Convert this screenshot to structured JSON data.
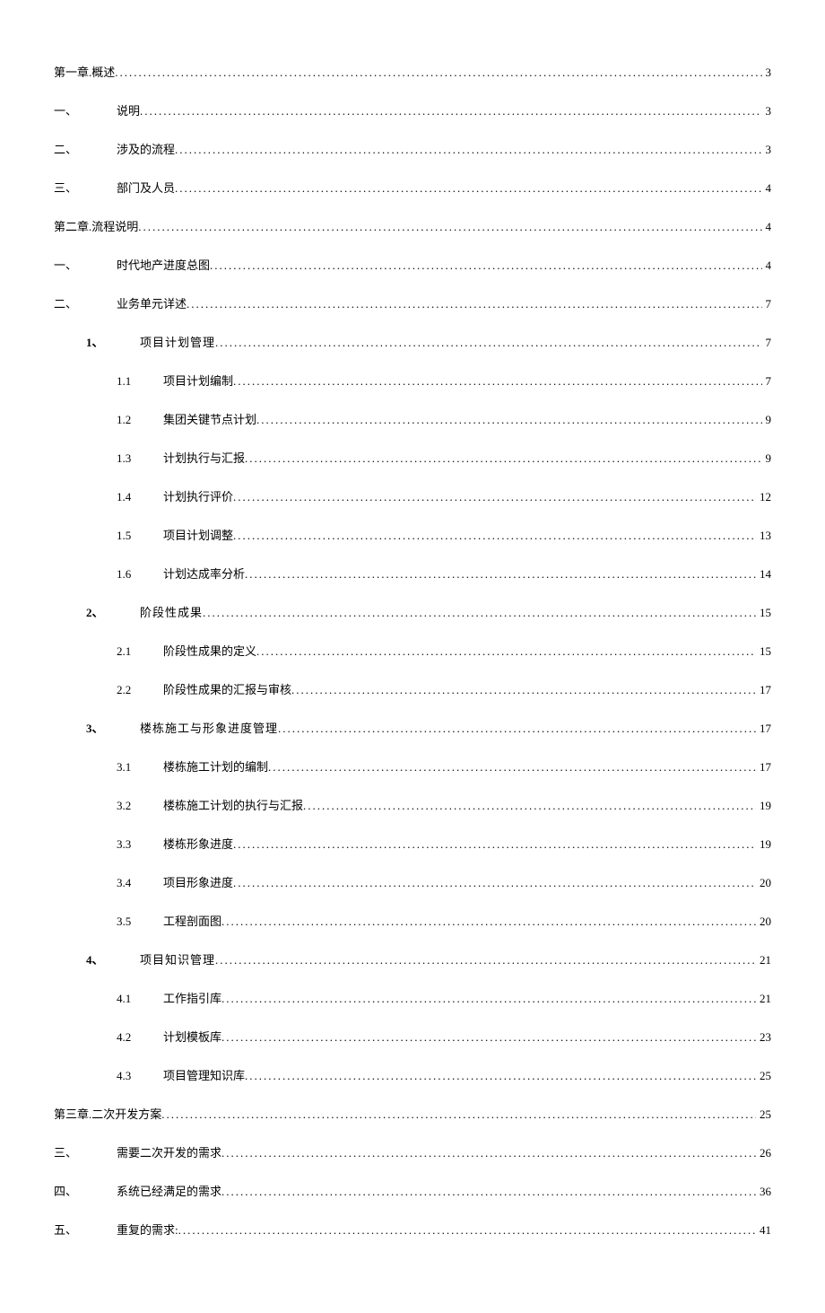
{
  "toc": [
    {
      "level": 0,
      "label": "第一章.",
      "title": "概述",
      "page": "3"
    },
    {
      "level": 1,
      "label": "一、",
      "title": "说明",
      "page": "3"
    },
    {
      "level": 1,
      "label": "二、",
      "title": "涉及的流程",
      "page": "3"
    },
    {
      "level": 1,
      "label": "三、",
      "title": "部门及人员",
      "page": "4"
    },
    {
      "level": 0,
      "label": "第二章.",
      "title": "流程说明",
      "page": "4"
    },
    {
      "level": 1,
      "label": "一、",
      "title": "时代地产进度总图",
      "page": "4"
    },
    {
      "level": 1,
      "label": "二、",
      "title": "业务单元详述",
      "page": "7"
    },
    {
      "level": 2,
      "num": "1、",
      "title": "项目计划管理",
      "page": "7"
    },
    {
      "level": 3,
      "num": "1.1",
      "title": "项目计划编制",
      "page": "7"
    },
    {
      "level": 3,
      "num": "1.2",
      "title": "集团关键节点计划",
      "page": "9"
    },
    {
      "level": 3,
      "num": "1.3",
      "title": "计划执行与汇报",
      "page": "9"
    },
    {
      "level": 3,
      "num": "1.4",
      "title": "计划执行评价",
      "page": "12"
    },
    {
      "level": 3,
      "num": "1.5",
      "title": "项目计划调整",
      "page": "13"
    },
    {
      "level": 3,
      "num": "1.6",
      "title": "计划达成率分析",
      "page": "14"
    },
    {
      "level": 2,
      "num": "2、",
      "title": "阶段性成果",
      "page": "15"
    },
    {
      "level": 3,
      "num": "2.1",
      "title": "阶段性成果的定义",
      "page": "15"
    },
    {
      "level": 3,
      "num": "2.2",
      "title": "阶段性成果的汇报与审核",
      "page": "17"
    },
    {
      "level": 2,
      "num": "3、",
      "title": "楼栋施工与形象进度管理",
      "page": "17"
    },
    {
      "level": 3,
      "num": "3.1",
      "title": "楼栋施工计划的编制",
      "page": "17"
    },
    {
      "level": 3,
      "num": "3.2",
      "title": "楼栋施工计划的执行与汇报",
      "page": "19"
    },
    {
      "level": 3,
      "num": "3.3",
      "title": "楼栋形象进度",
      "page": "19"
    },
    {
      "level": 3,
      "num": "3.4",
      "title": "项目形象进度",
      "page": "20"
    },
    {
      "level": 3,
      "num": "3.5",
      "title": "工程剖面图",
      "page": "20"
    },
    {
      "level": 2,
      "num": "4、",
      "title": "项目知识管理",
      "page": "21"
    },
    {
      "level": 3,
      "num": "4.1",
      "title": "工作指引库",
      "page": "21"
    },
    {
      "level": 3,
      "num": "4.2",
      "title": "计划模板库",
      "page": "23"
    },
    {
      "level": 3,
      "num": "4.3",
      "title": "项目管理知识库",
      "page": "25"
    },
    {
      "level": 0,
      "label": "第三章.",
      "title": "二次开发方案",
      "page": "25"
    },
    {
      "level": 1,
      "label": "三、",
      "title": "需要二次开发的需求",
      "page": "26"
    },
    {
      "level": 1,
      "label": "四、",
      "title": "系统已经满足的需求",
      "page": "36"
    },
    {
      "level": 1,
      "label": "五、",
      "title": "重复的需求:",
      "page": "41"
    }
  ]
}
